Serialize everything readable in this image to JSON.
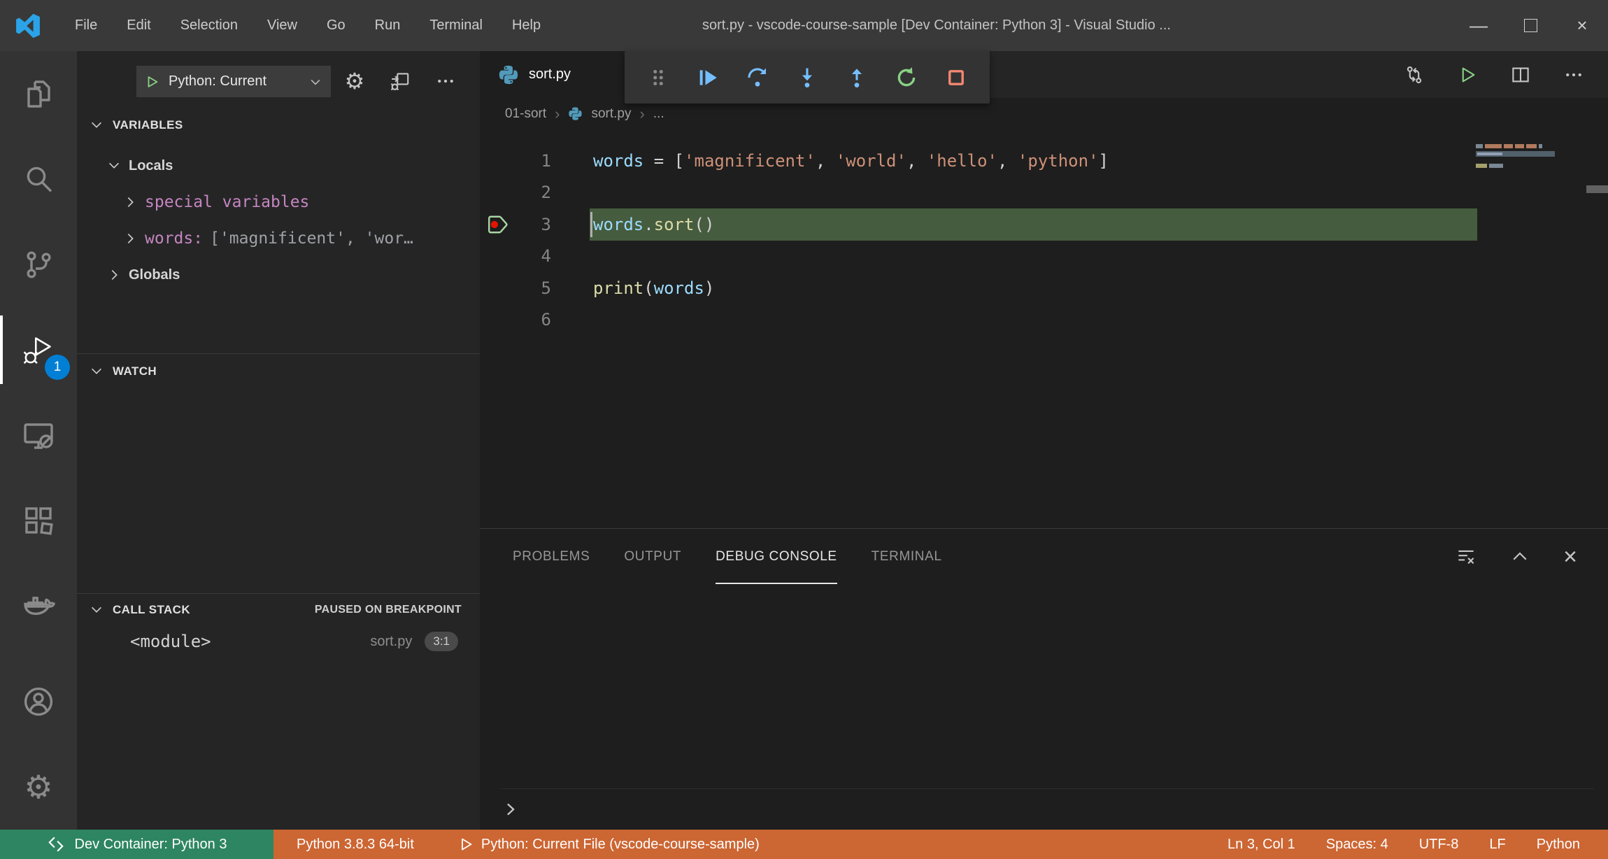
{
  "title_bar": {
    "menus": [
      "File",
      "Edit",
      "Selection",
      "View",
      "Go",
      "Run",
      "Terminal",
      "Help"
    ],
    "title": "sort.py - vscode-course-sample [Dev Container: Python 3] - Visual Studio ...",
    "minimize": "—",
    "close": "×"
  },
  "activity_bar": {
    "items": [
      "explorer",
      "search",
      "source-control",
      "run-and-debug",
      "remote-explorer",
      "extensions",
      "docker",
      "accounts",
      "settings"
    ],
    "debug_badge": "1"
  },
  "sidebar": {
    "run_toolbar": {
      "config_label": "Python: Current"
    },
    "variables": {
      "header": "VARIABLES",
      "locals": "Locals",
      "special": "special variables",
      "words_name": "words:",
      "words_value": "['magnificent', 'wor…",
      "globals": "Globals"
    },
    "watch": {
      "header": "WATCH"
    },
    "call_stack": {
      "header": "CALL STACK",
      "status": "PAUSED ON BREAKPOINT",
      "frame": {
        "name": "<module>",
        "file": "sort.py",
        "position": "3:1"
      }
    }
  },
  "editor": {
    "tab": {
      "label": "sort.py"
    },
    "breadcrumbs": {
      "folder": "01-sort",
      "file": "sort.py",
      "symbol": "..."
    },
    "code": {
      "lines": [
        {
          "num": "1",
          "tokens": [
            {
              "t": "words",
              "c": "v"
            },
            {
              "t": " = [",
              "c": "p"
            },
            {
              "t": "'magnificent'",
              "c": "s"
            },
            {
              "t": ", ",
              "c": "p"
            },
            {
              "t": "'world'",
              "c": "s"
            },
            {
              "t": ", ",
              "c": "p"
            },
            {
              "t": "'hello'",
              "c": "s"
            },
            {
              "t": ", ",
              "c": "p"
            },
            {
              "t": "'python'",
              "c": "s"
            },
            {
              "t": "]",
              "c": "p"
            }
          ]
        },
        {
          "num": "2",
          "tokens": []
        },
        {
          "num": "3",
          "current": true,
          "breakpoint": true,
          "cursor": true,
          "tokens": [
            {
              "t": "words",
              "c": "v"
            },
            {
              "t": ".",
              "c": "p"
            },
            {
              "t": "sort",
              "c": "f"
            },
            {
              "t": "()",
              "c": "p"
            }
          ]
        },
        {
          "num": "4",
          "tokens": []
        },
        {
          "num": "5",
          "tokens": [
            {
              "t": "print",
              "c": "f"
            },
            {
              "t": "(",
              "c": "p"
            },
            {
              "t": "words",
              "c": "v"
            },
            {
              "t": ")",
              "c": "p"
            }
          ]
        },
        {
          "num": "6",
          "tokens": []
        }
      ]
    }
  },
  "panel": {
    "tabs": {
      "problems": "PROBLEMS",
      "output": "OUTPUT",
      "debug_console": "DEBUG CONSOLE",
      "terminal": "TERMINAL"
    },
    "active_tab": "DEBUG CONSOLE"
  },
  "status_bar": {
    "remote_label": "Dev Container: Python 3",
    "python_version": "Python 3.8.3 64-bit",
    "launch_config": "Python: Current File (vscode-course-sample)",
    "cursor_position": "Ln 3, Col 1",
    "indentation": "Spaces: 4",
    "encoding": "UTF-8",
    "eol": "LF",
    "language": "Python"
  },
  "colors": {
    "debug_blue": "#75beff",
    "debug_green": "#89d185",
    "debug_red": "#f48771",
    "statusbar_debug": "#cc6633",
    "statusbar_remote": "#2e8561",
    "current_line_highlight": "#465c3e",
    "badge_blue": "#007fd4"
  }
}
